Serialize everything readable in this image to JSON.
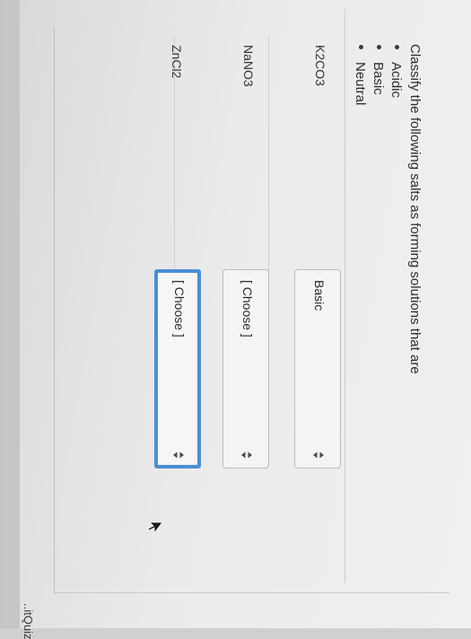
{
  "question": {
    "prompt": "Classify the following salts as forming solutions that are",
    "options": [
      "Acidic",
      "Basic",
      "Neutral"
    ]
  },
  "items": [
    {
      "label": "K2CO3",
      "selected": "Basic"
    },
    {
      "label": "NaNO3",
      "selected": "[ Choose ]"
    },
    {
      "label": "ZnCl2",
      "selected": "[ Choose ]"
    }
  ],
  "footer": {
    "partial_text": "..itQuiz"
  },
  "colors": {
    "focus_border": "#4a8fd6",
    "text": "#2d2d2d",
    "page_background": "#ebebeb"
  },
  "icons": {
    "select_arrows": "updown-arrows-icon",
    "mouse_cursor": "cursor-arrow-icon"
  }
}
